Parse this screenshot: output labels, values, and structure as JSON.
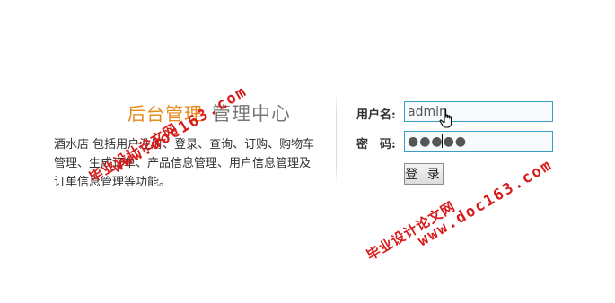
{
  "header": {
    "brand": "后台管理",
    "title": "管理中心"
  },
  "intro": {
    "text": "酒水店 包括用户注册、登录、查询、订购、购物车管理、生成订单、产品信息管理、用户信息管理及订单信息管理等功能。"
  },
  "login": {
    "username_label": "用户名:",
    "username_value": "admin",
    "password_label": "密　码:",
    "password_value": "●●●●●",
    "submit_label": "登 录"
  },
  "watermarks": {
    "url_text": "www.doc163.com",
    "cn_text": "毕业设计论文网"
  },
  "colors": {
    "brand": "#e88a1c",
    "title": "#777777",
    "input_border": "#3a9ec2",
    "watermark": "#d71c1c"
  },
  "icons": {
    "cursor": "hand-pointer-icon"
  }
}
